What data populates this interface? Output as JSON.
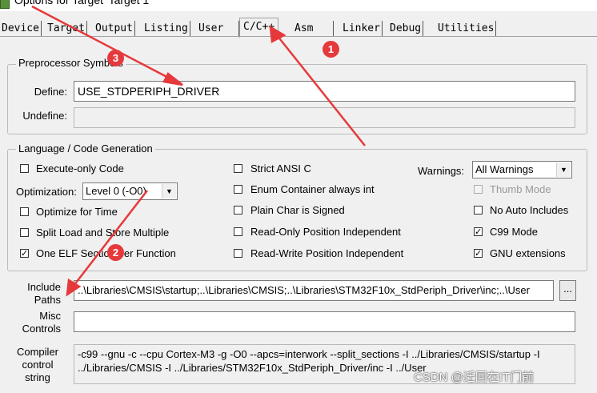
{
  "window": {
    "title": "Options for Target 'Target 1'"
  },
  "tabs": [
    {
      "label": "Device",
      "active": false
    },
    {
      "label": "Target",
      "active": false
    },
    {
      "label": "Output",
      "active": false
    },
    {
      "label": "Listing",
      "active": false
    },
    {
      "label": "User",
      "active": false
    },
    {
      "label": "C/C++",
      "active": true
    },
    {
      "label": "Asm",
      "active": false
    },
    {
      "label": "Linker",
      "active": false
    },
    {
      "label": "Debug",
      "active": false
    },
    {
      "label": "Utilities",
      "active": false
    }
  ],
  "preprocessor": {
    "title": "Preprocessor Symbols",
    "define_label": "Define:",
    "define_value": "USE_STDPERIPH_DRIVER",
    "undefine_label": "Undefine:",
    "undefine_value": ""
  },
  "language": {
    "title": "Language / Code Generation",
    "execute_only": {
      "label": "Execute-only Code",
      "checked": false
    },
    "optimization_label": "Optimization:",
    "optimization_value": "Level 0 (-O0)",
    "optimize_time": {
      "label": "Optimize for Time",
      "checked": false
    },
    "split_load": {
      "label": "Split Load and Store Multiple",
      "checked": false
    },
    "one_elf": {
      "label": "One ELF Section per Function",
      "checked": true
    },
    "strict_ansi": {
      "label": "Strict ANSI C",
      "checked": false
    },
    "enum_container": {
      "label": "Enum Container always int",
      "checked": false
    },
    "plain_char": {
      "label": "Plain Char is Signed",
      "checked": false
    },
    "ro_position": {
      "label": "Read-Only Position Independent",
      "checked": false
    },
    "rw_position": {
      "label": "Read-Write Position Independent",
      "checked": false
    },
    "warnings_label": "Warnings:",
    "warnings_value": "All Warnings",
    "thumb_mode": {
      "label": "Thumb Mode",
      "checked": false,
      "disabled": true
    },
    "no_auto_includes": {
      "label": "No Auto Includes",
      "checked": false
    },
    "c99_mode": {
      "label": "C99 Mode",
      "checked": true
    },
    "gnu_extensions": {
      "label": "GNU extensions",
      "checked": true
    }
  },
  "include": {
    "label_line1": "Include",
    "label_line2": "Paths",
    "value": "..\\Libraries\\CMSIS\\startup;..\\Libraries\\CMSIS;..\\Libraries\\STM32F10x_StdPeriph_Driver\\inc;..\\User",
    "browse_label": "..."
  },
  "misc": {
    "label_line1": "Misc",
    "label_line2": "Controls",
    "value": ""
  },
  "compiler": {
    "label_line1": "Compiler",
    "label_line2": "control",
    "label_line3": "string",
    "line1": "-c99 --gnu -c --cpu Cortex-M3 -g -O0 --apcs=interwork --split_sections -I ../Libraries/CMSIS/startup -I",
    "line2": "../Libraries/CMSIS -I ../Libraries/STM32F10x_StdPeriph_Driver/inc -I ../User"
  },
  "annotations": {
    "badge1": "1",
    "badge2": "2",
    "badge3": "3",
    "arrow_color": "#e5393b"
  },
  "watermark": "CSDN @迁回在IT门前",
  "colors": {
    "background": "#f0f0f0",
    "badge": "#e5393b",
    "border": "#7a7a7a"
  }
}
